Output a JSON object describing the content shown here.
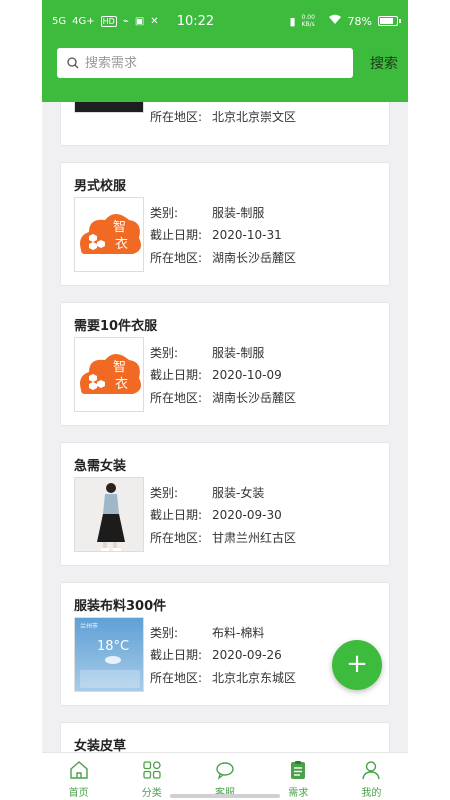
{
  "status_bar": {
    "network": "5G",
    "network2": "4G+",
    "hd": "HD",
    "time": "10:22",
    "speed": "0.00 KB/s",
    "battery": "78%"
  },
  "search": {
    "placeholder": "搜索需求",
    "button_label": "搜索"
  },
  "partial_card": {
    "region_label": "所在地区:",
    "region_value": "北京北京崇文区"
  },
  "labels": {
    "category": "类别:",
    "deadline": "截止日期:",
    "region": "所在地区:"
  },
  "cards": [
    {
      "title": "男式校服",
      "category": "服装-制服",
      "deadline": "2020-10-31",
      "region": "湖南长沙岳麓区",
      "image": "zhiyi-logo"
    },
    {
      "title": "需要10件衣服",
      "category": "服装-制服",
      "deadline": "2020-10-09",
      "region": "湖南长沙岳麓区",
      "image": "zhiyi-logo"
    },
    {
      "title": "急需女装",
      "category": "服装-女装",
      "deadline": "2020-09-30",
      "region": "甘肃兰州红古区",
      "image": "woman-photo"
    },
    {
      "title": "服装布料300件",
      "category": "布料-棉料",
      "deadline": "2020-09-26",
      "region": "北京北京东城区",
      "image": "weather-screenshot"
    }
  ],
  "last_card": {
    "title": "女装皮草"
  },
  "weather_thumb": {
    "temp": "18°C",
    "city": "兰州市"
  },
  "logo_text": {
    "line1": "智",
    "line2": "衣"
  },
  "fab": {
    "icon": "plus-icon",
    "label": "+"
  },
  "tabs": [
    {
      "label": "首页",
      "icon": "home-icon"
    },
    {
      "label": "分类",
      "icon": "grid-icon"
    },
    {
      "label": "客服",
      "icon": "chat-icon"
    },
    {
      "label": "需求",
      "icon": "clipboard-icon",
      "active": true
    },
    {
      "label": "我的",
      "icon": "user-icon"
    }
  ],
  "colors": {
    "accent": "#3dbb3d",
    "background": "#f0f0f2"
  }
}
